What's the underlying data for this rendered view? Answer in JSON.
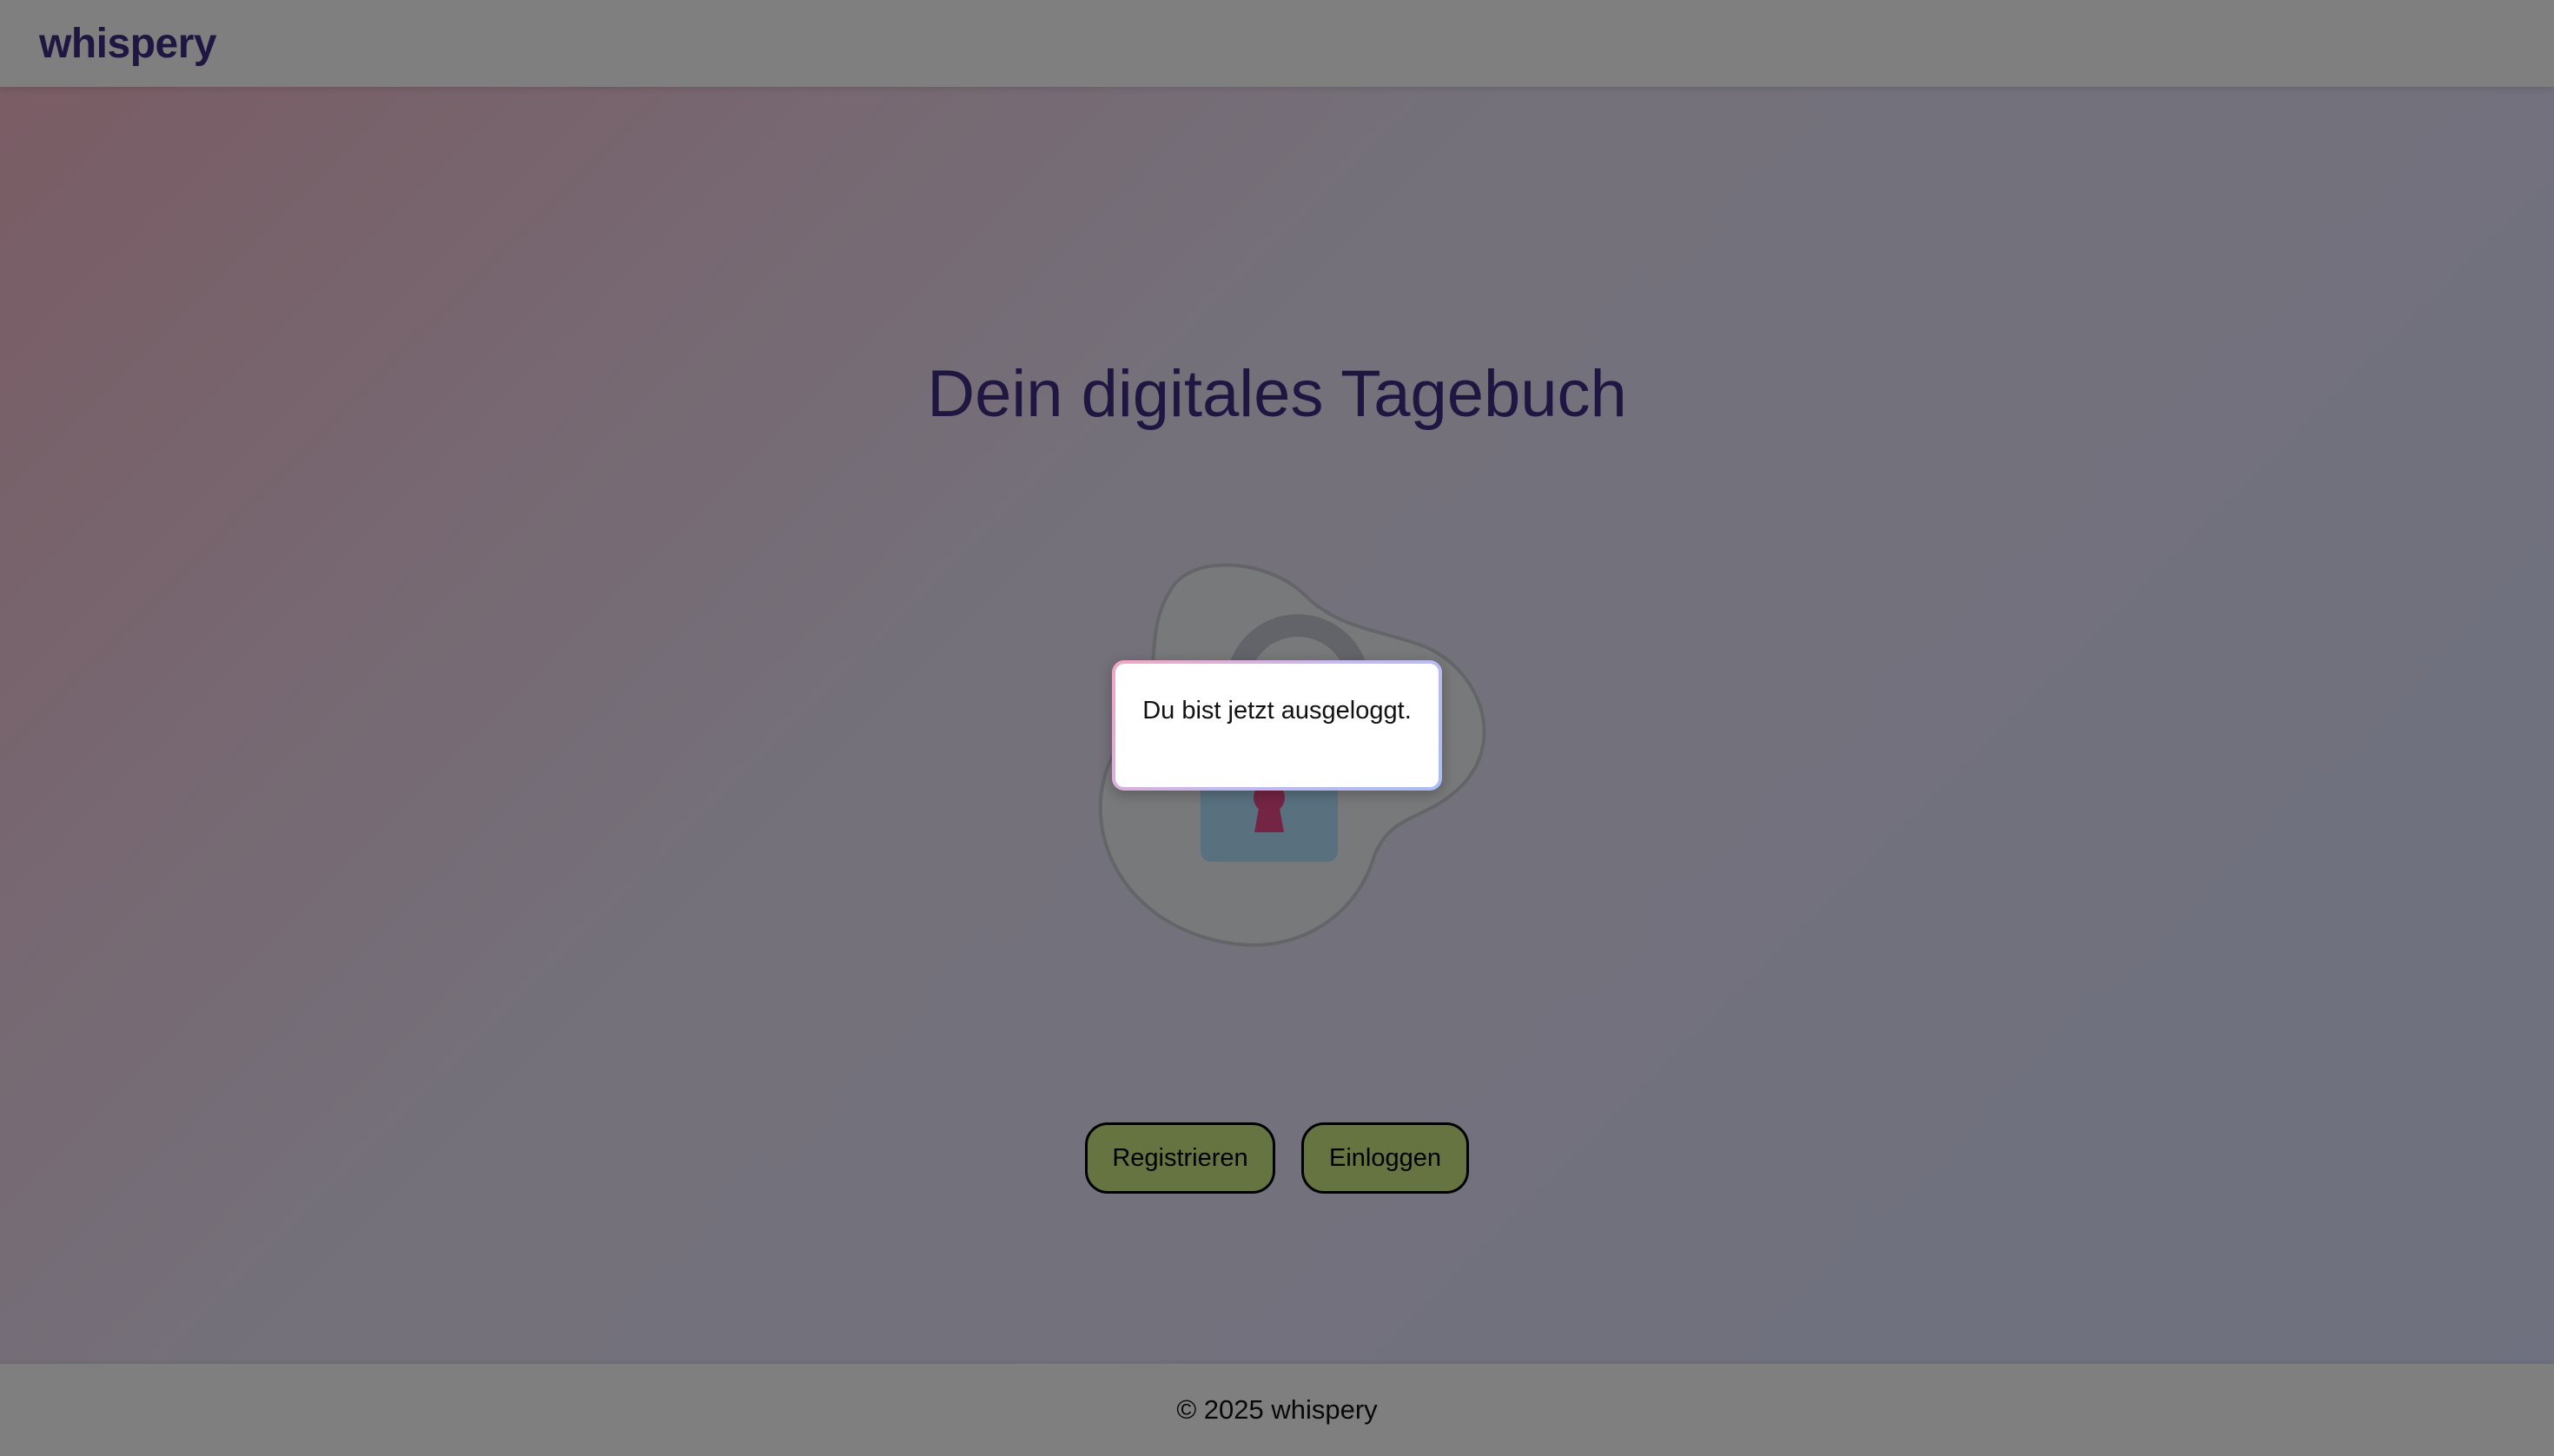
{
  "header": {
    "logo": "whispery"
  },
  "hero": {
    "title": "Dein digitales Tagebuch",
    "illustration_icon": "padlock-icon"
  },
  "actions": {
    "register_label": "Registrieren",
    "login_label": "Einloggen"
  },
  "footer": {
    "copyright": "© 2025 whispery"
  },
  "modal": {
    "message": "Du bist jetzt ausgeloggt."
  },
  "colors": {
    "brand": "#3e2f83",
    "button_bg": "#cce882",
    "overlay": "rgba(0,0,0,0.5)",
    "lock_body": "#b3e3ff",
    "keyhole": "#e94a86",
    "blob": "#f1f2f4"
  }
}
